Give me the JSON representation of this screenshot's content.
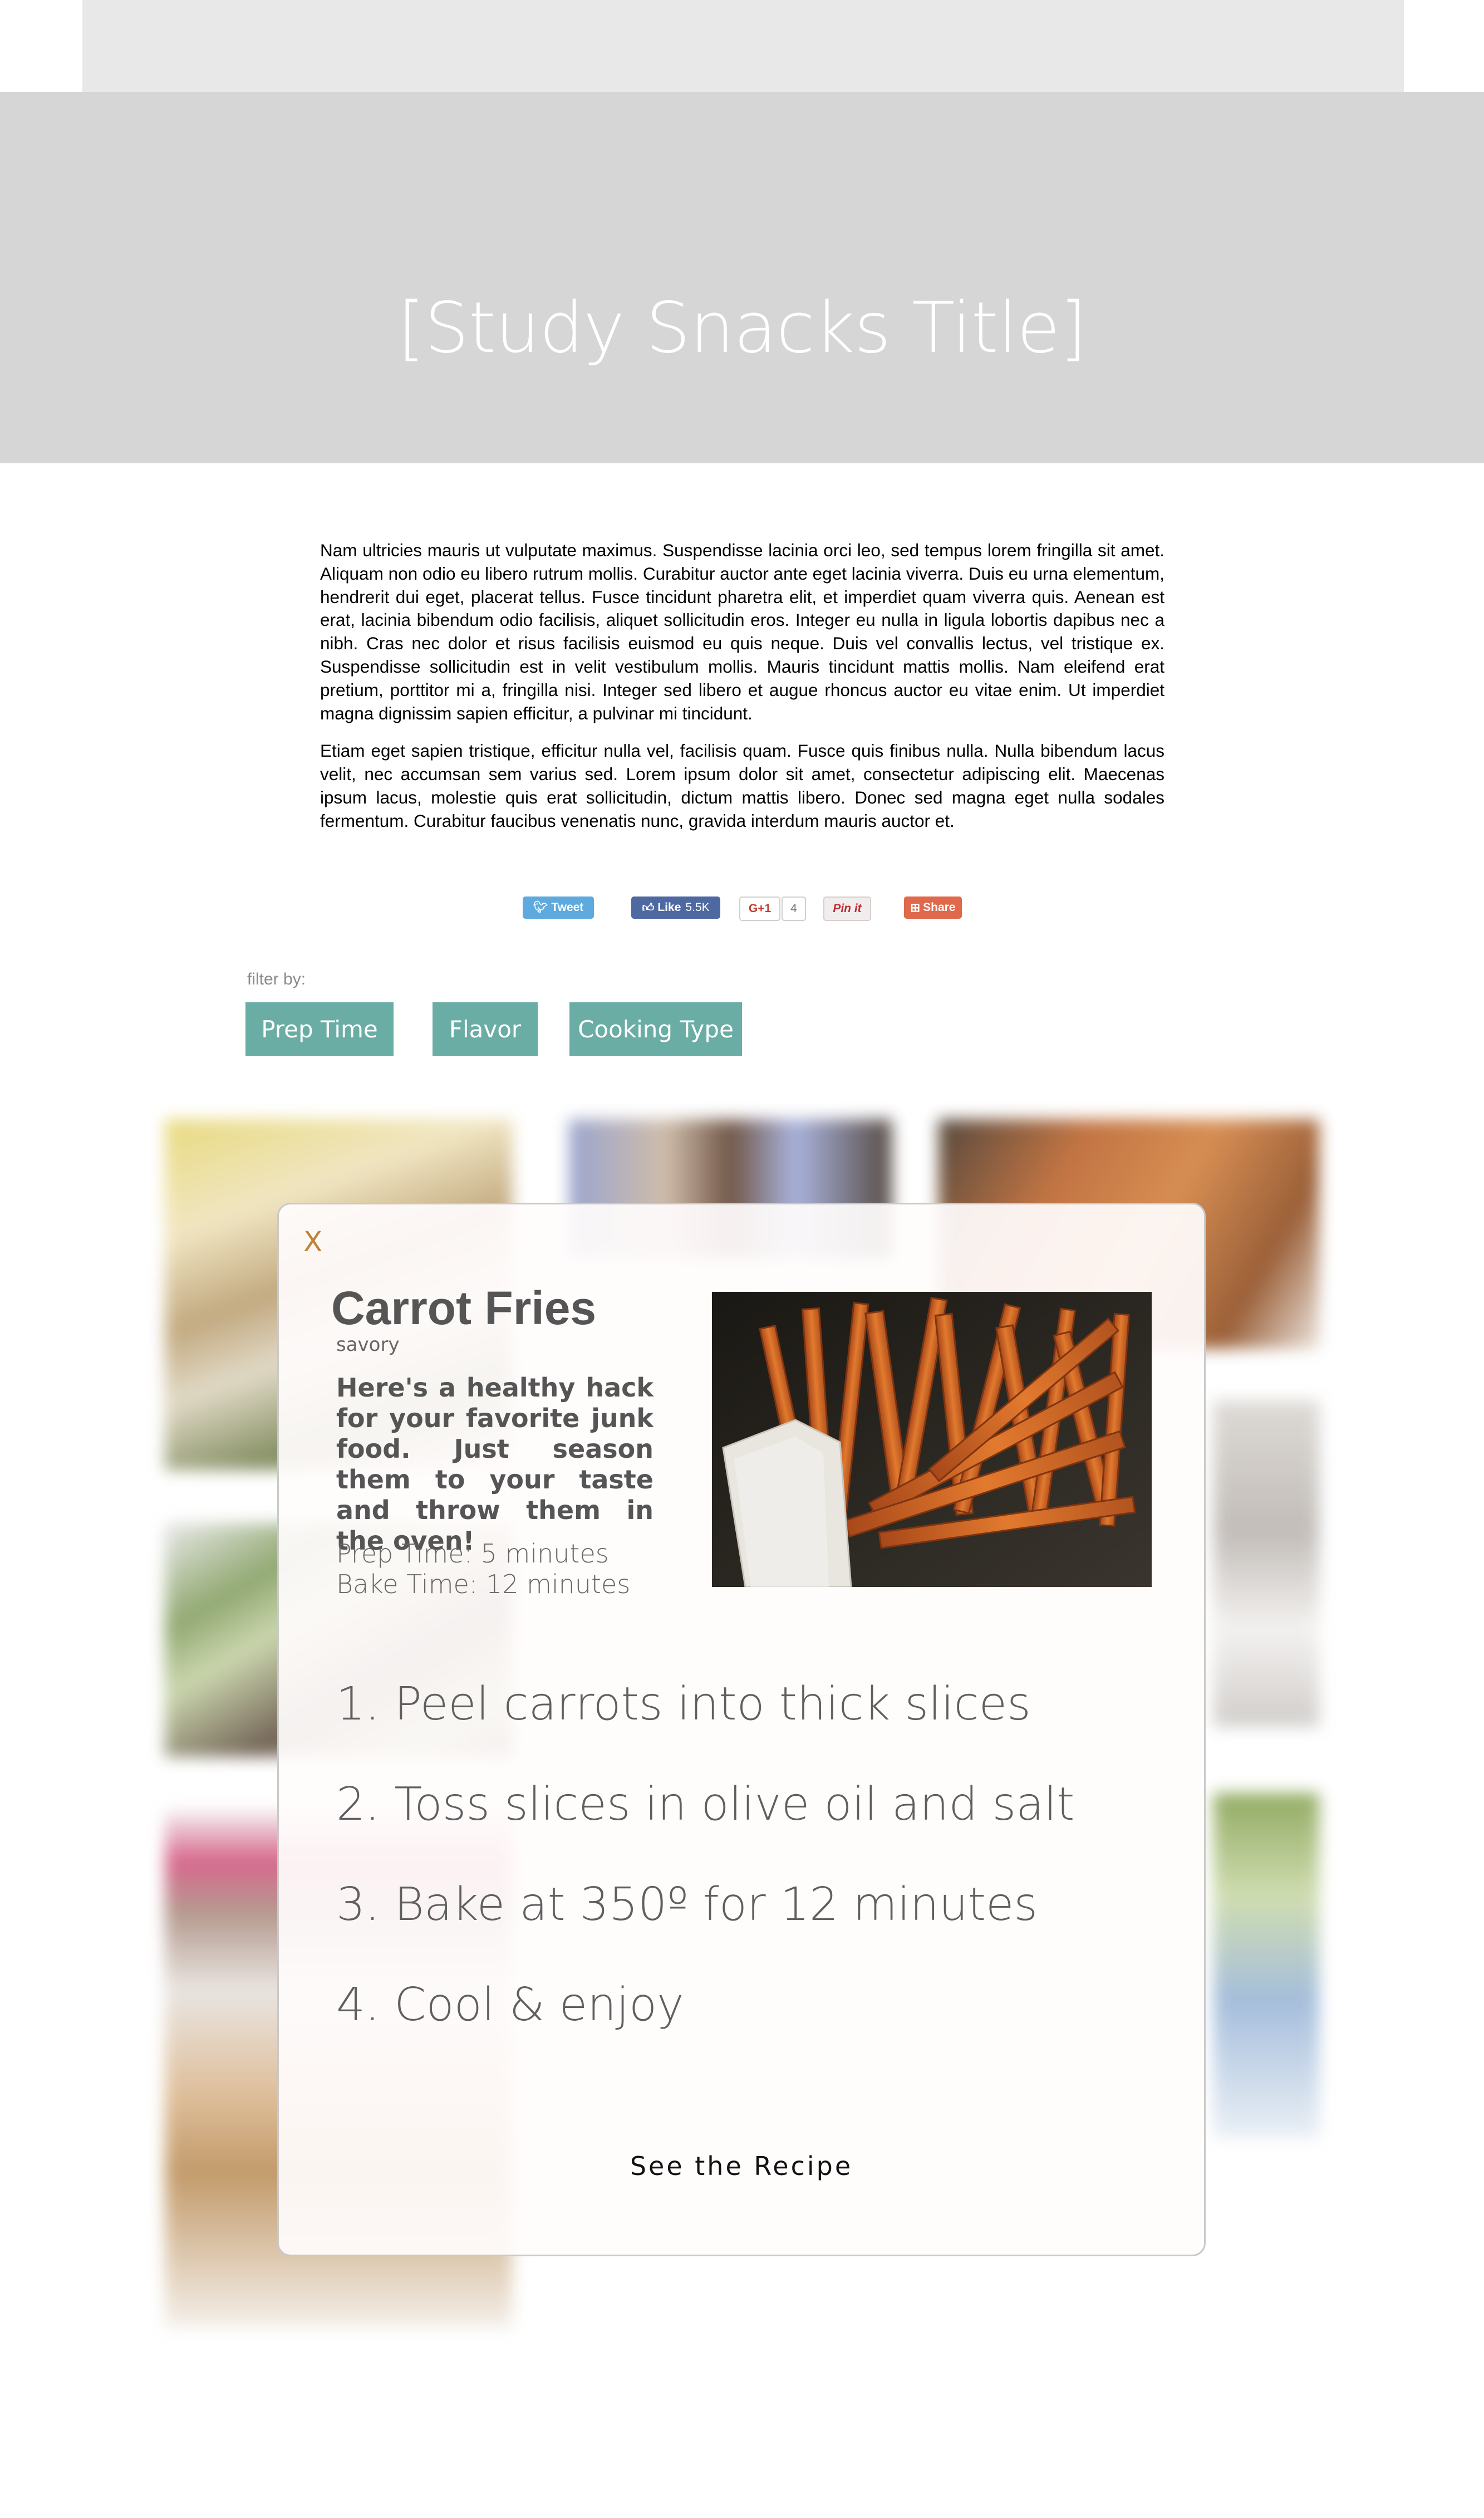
{
  "hero": {
    "title": "[Study Snacks Title]"
  },
  "intro": {
    "paragraphs": [
      "Nam ultricies mauris ut vulputate maximus. Suspendisse lacinia orci leo, sed tempus lorem fringilla sit amet. Aliquam non odio eu libero rutrum mollis. Curabitur auctor ante eget lacinia viverra. Duis eu urna elementum, hendrerit dui eget, placerat tellus. Fusce tincidunt pharetra elit, et imperdiet quam viverra quis. Aenean est erat, lacinia bibendum odio facilisis, aliquet sollicitudin eros. Integer eu nulla in ligula lobortis dapibus nec a nibh. Cras nec dolor et risus facilisis euismod eu quis neque. Duis vel convallis lectus, vel tristique ex. Suspendisse sollicitudin est in velit vestibulum mollis. Mauris tincidunt mattis mollis. Nam eleifend erat pretium, porttitor mi a, fringilla nisi. Integer sed libero et augue rhoncus auctor eu vitae enim. Ut imperdiet magna dignissim sapien efficitur, a pulvinar mi tincidunt.",
      "Etiam eget sapien tristique, efficitur nulla vel, facilisis quam. Fusce quis finibus nulla. Nulla bibendum lacus velit, nec accumsan sem varius sed. Lorem ipsum dolor sit amet, consectetur adipiscing elit. Maecenas ipsum lacus, molestie quis erat sollicitudin, dictum mattis libero. Donec sed magna eget nulla sodales fermentum. Curabitur faucibus venenatis nunc, gravida interdum mauris auctor et."
    ]
  },
  "share": {
    "tweet": "Tweet",
    "like": "Like",
    "like_count": "5.5K",
    "gplus": "G+1",
    "gplus_count": "4",
    "pin": "Pin it",
    "share": "Share"
  },
  "filter": {
    "label": "filter by:",
    "buttons": [
      "Prep Time",
      "Flavor",
      "Cooking Type"
    ]
  },
  "modal": {
    "close": "X",
    "title": "Carrot Fries",
    "category": "savory",
    "description": "Here's a healthy hack for your favorite junk food. Just season them to your taste and throw them in the oven!",
    "prep_time": "Prep Time: 5 minutes",
    "bake_time": "Bake Time: 12 minutes",
    "steps": [
      "1. Peel carrots into thick slices",
      "2. Toss slices in olive oil and salt",
      "3. Bake at 350º for 12 minutes",
      "4. Cool & enjoy"
    ],
    "cta": "See the Recipe"
  },
  "colors": {
    "accent": "#6aada4",
    "close": "#c0823a",
    "hero_bg": "#d6d6d6"
  }
}
